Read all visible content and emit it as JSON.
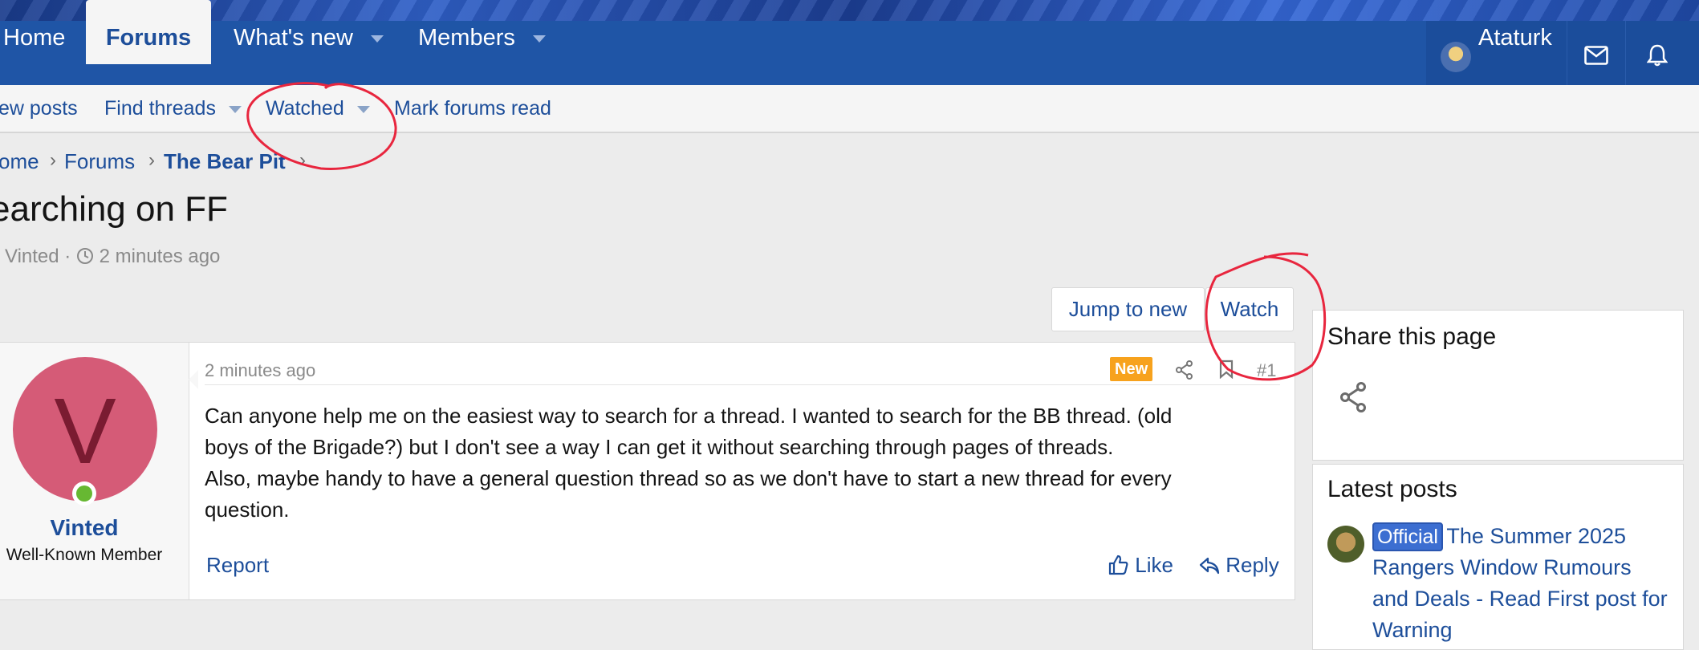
{
  "nav": {
    "home": "Home",
    "forums": "Forums",
    "whats_new": "What's new",
    "members": "Members",
    "username": "Ataturk"
  },
  "subnav": {
    "new_posts": "ew posts",
    "find_threads": "Find threads",
    "watched": "Watched",
    "mark_read": "Mark forums read"
  },
  "breadcrumb": {
    "home": "ome",
    "forums": "Forums",
    "bear_pit": "The Bear Pit"
  },
  "thread": {
    "title": "earching on FF",
    "author": "Vinted",
    "separator": "·",
    "time": "2 minutes ago"
  },
  "buttons": {
    "jump_to_new": "Jump to new",
    "watch": "Watch"
  },
  "post": {
    "avatar_letter": "V",
    "username": "Vinted",
    "user_title": "Well-Known Member",
    "date": "2 minutes ago",
    "badge": "New",
    "number": "#1",
    "body_line1": "Can anyone help me on the easiest way to search for a thread. I wanted to search for the BB thread. (old",
    "body_line2": "boys of the Brigade?) but I don't see a way I can get it without searching through pages of threads.",
    "body_line3": "Also, maybe handy to have a general question thread so as we don't have to start a new thread for every",
    "body_line4": "question.",
    "report": "Report",
    "like": "Like",
    "reply": "Reply"
  },
  "sidebar": {
    "share_title": "Share this page",
    "latest_title": "Latest posts",
    "latest_tag": "Official",
    "latest_link": "The Summer 2025 Rangers Window Rumours and Deals - Read First post for Warning"
  },
  "colors": {
    "nav_blue": "#1f55a6",
    "link_blue": "#1d4e9a",
    "badge_orange": "#f7a21d",
    "annotation_red": "#e8263e"
  },
  "icons": {
    "user_avatar": "avatar",
    "mail": "envelope-icon",
    "alerts": "bell-icon",
    "clock": "clock-icon",
    "share": "share-icon",
    "bookmark": "bookmark-icon",
    "like": "thumbs-up-icon",
    "reply": "reply-icon"
  }
}
